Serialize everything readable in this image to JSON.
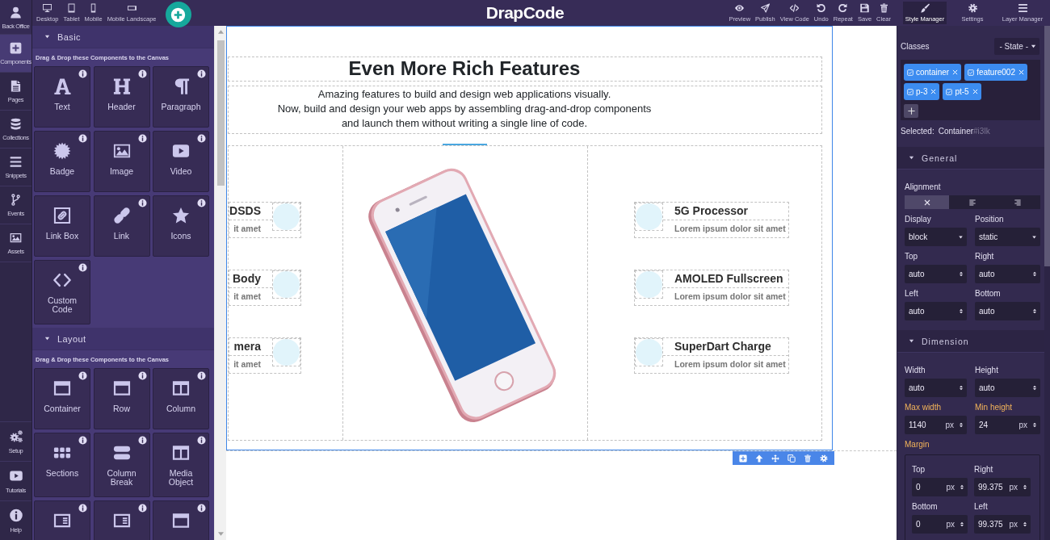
{
  "sidebar": {
    "items": [
      {
        "label": "Back Office",
        "selected": false
      },
      {
        "label": "Components",
        "selected": true
      },
      {
        "label": "Pages",
        "selected": false
      },
      {
        "label": "Collections",
        "selected": false
      },
      {
        "label": "Snippets",
        "selected": false
      },
      {
        "label": "Events",
        "selected": false
      },
      {
        "label": "Assets",
        "selected": false
      }
    ],
    "bottom_items": [
      {
        "label": "Setup"
      },
      {
        "label": "Tutorials"
      },
      {
        "label": "Help"
      }
    ]
  },
  "toolbar": {
    "devices": [
      {
        "label": "Desktop"
      },
      {
        "label": "Tablet"
      },
      {
        "label": "Mobile"
      },
      {
        "label": "Mobile Landscape"
      }
    ],
    "logo": "DrapCode",
    "actions": [
      {
        "label": "Preview"
      },
      {
        "label": "Publish"
      },
      {
        "label": "View Code"
      },
      {
        "label": "Undo"
      },
      {
        "label": "Repeat"
      },
      {
        "label": "Save"
      },
      {
        "label": "Clear"
      }
    ],
    "panels": [
      {
        "label": "Style Manager",
        "selected": true
      },
      {
        "label": "Settings",
        "selected": false
      },
      {
        "label": "Layer Manager",
        "selected": false
      }
    ]
  },
  "components_panel": {
    "sections": [
      {
        "title": "Basic",
        "expanded": true,
        "hint": "Drag & Drop these Components to the Canvas",
        "tiles": [
          {
            "label": "Text",
            "info": true
          },
          {
            "label": "Header",
            "info": true
          },
          {
            "label": "Paragraph",
            "info": true
          },
          {
            "label": "Badge",
            "info": true
          },
          {
            "label": "Image",
            "info": true
          },
          {
            "label": "Video",
            "info": true
          },
          {
            "label": "Link Box",
            "info": false
          },
          {
            "label": "Link",
            "info": true
          },
          {
            "label": "Icons",
            "info": true
          },
          {
            "label": "Custom Code",
            "info": true
          }
        ]
      },
      {
        "title": "Layout",
        "expanded": true,
        "hint": "Drag & Drop these Components to the Canvas",
        "tiles": [
          {
            "label": "Container",
            "info": true
          },
          {
            "label": "Row",
            "info": true
          },
          {
            "label": "Column",
            "info": true
          },
          {
            "label": "Sections",
            "info": true
          },
          {
            "label": "Column Break",
            "info": true
          },
          {
            "label": "Media Object",
            "info": true
          },
          {
            "info": true
          },
          {
            "info": true
          },
          {
            "info": true
          }
        ]
      }
    ]
  },
  "canvas": {
    "heading": "Even More Rich Features",
    "paragraph": [
      "Amazing features to build and design web applications visually.",
      "Now, build and design your web apps by assembling drag-and-drop components",
      "and launch them without writing a single line of code."
    ],
    "left_features": [
      {
        "title": "DSDS",
        "text": "it amet"
      },
      {
        "title": "Body",
        "text": "it amet"
      },
      {
        "title": "mera",
        "text": "it amet"
      }
    ],
    "right_features": [
      {
        "title": "5G Processor",
        "text": "Lorem ipsum dolor sit amet"
      },
      {
        "title": "AMOLED Fullscreen",
        "text": "Lorem ipsum dolor sit amet"
      },
      {
        "title": "SuperDart Charge",
        "text": "Lorem ipsum dolor sit amet"
      }
    ]
  },
  "style_manager": {
    "classes_label": "Classes",
    "state_select": "- State -",
    "tags": [
      {
        "label": "container",
        "checked": true
      },
      {
        "label": "feature002",
        "checked": true
      },
      {
        "label": "p-3",
        "checked": true
      },
      {
        "label": "pt-5",
        "checked": true
      }
    ],
    "selected_label": "Selected:",
    "selected_name": "Container",
    "selected_id": "#i3lk",
    "sections": [
      {
        "title": "General",
        "expanded": true,
        "fields": [
          {
            "kind": "radio",
            "label": "Alignment",
            "modified": false,
            "options": [
              {
                "selected": true
              },
              {
                "selected": false
              },
              {
                "selected": false
              }
            ]
          },
          {
            "kind": "select",
            "label": "Display",
            "value": "block",
            "modified": false
          },
          {
            "kind": "select",
            "label": "Position",
            "value": "static",
            "modified": false
          },
          {
            "kind": "number",
            "label": "Top",
            "value": "auto",
            "modified": false
          },
          {
            "kind": "number",
            "label": "Right",
            "value": "auto",
            "modified": false
          },
          {
            "kind": "number",
            "label": "Left",
            "value": "auto",
            "modified": false
          },
          {
            "kind": "number",
            "label": "Bottom",
            "value": "auto",
            "modified": false
          }
        ]
      },
      {
        "title": "Dimension",
        "expanded": true,
        "fields": [
          {
            "kind": "number",
            "label": "Width",
            "value": "auto",
            "modified": false
          },
          {
            "kind": "number",
            "label": "Height",
            "value": "auto",
            "modified": false
          },
          {
            "kind": "number",
            "label": "Max width",
            "value": "1140",
            "unit": "px",
            "modified": true
          },
          {
            "kind": "number",
            "label": "Min height",
            "value": "24",
            "unit": "px",
            "modified": true
          },
          {
            "kind": "group",
            "label": "Margin",
            "modified": true,
            "fields": [
              {
                "kind": "number",
                "label": "Top",
                "value": "0",
                "unit": "px",
                "modified": false
              },
              {
                "kind": "number",
                "label": "Right",
                "value": "99.375",
                "unit": "px",
                "modified": false
              },
              {
                "kind": "number",
                "label": "Bottom",
                "value": "0",
                "unit": "px",
                "modified": false
              },
              {
                "kind": "number",
                "label": "Left",
                "value": "99.375",
                "unit": "px",
                "modified": false
              }
            ]
          }
        ]
      }
    ]
  }
}
